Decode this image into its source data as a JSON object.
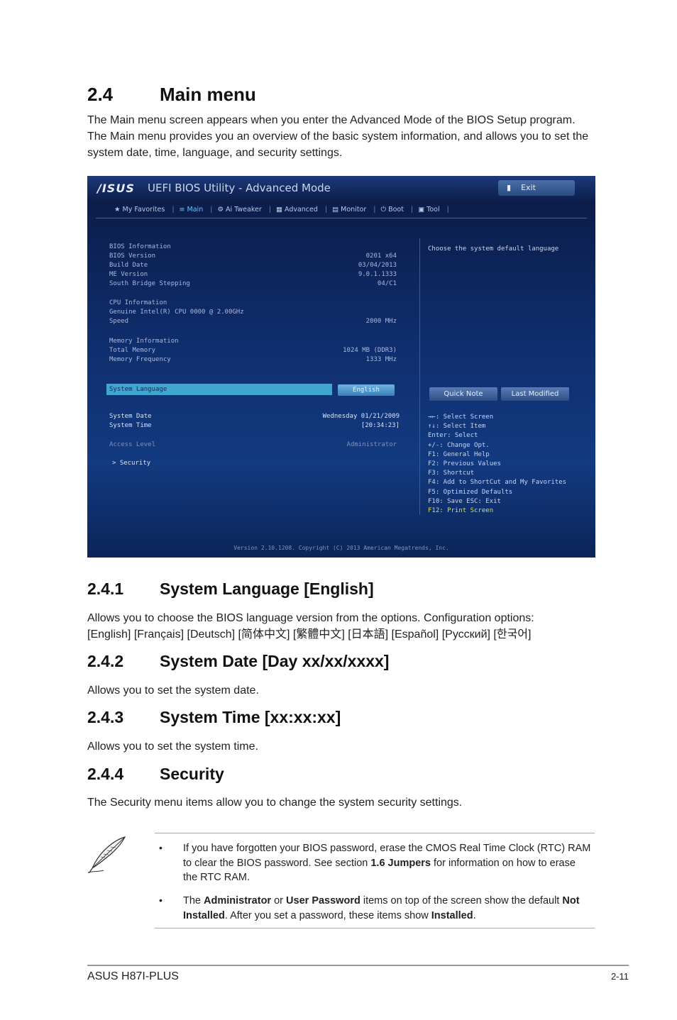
{
  "section": {
    "num": "2.4",
    "title": "Main menu",
    "intro": "The Main menu screen appears when you enter the Advanced Mode of the BIOS Setup program. The Main menu provides you an overview of the basic system information, and allows you to set the system date, time, language, and security settings."
  },
  "bios": {
    "logo": "/ISUS",
    "title": "UEFI BIOS Utility - Advanced Mode",
    "exit_label": "Exit",
    "tabs": [
      {
        "label": "My Favorites"
      },
      {
        "label": "Main"
      },
      {
        "label": "Ai Tweaker"
      },
      {
        "label": "Advanced"
      },
      {
        "label": "Monitor"
      },
      {
        "label": "Boot"
      },
      {
        "label": "Tool"
      }
    ],
    "bios_info": {
      "header": "BIOS Information",
      "version_label": "BIOS Version",
      "version": "0201 x64",
      "build_label": "Build Date",
      "build": "03/04/2013",
      "me_label": "ME Version",
      "me": "9.0.1.1333",
      "sb_label": "South Bridge Stepping",
      "sb": "04/C1"
    },
    "cpu_info": {
      "header": "CPU Information",
      "name": "Genuine Intel(R) CPU 0000 @ 2.00GHz",
      "speed_label": "Speed",
      "speed": "2000 MHz"
    },
    "mem_info": {
      "header": "Memory Information",
      "total_label": "Total Memory",
      "total": "1024 MB (DDR3)",
      "freq_label": "Memory Frequency",
      "freq": "1333 MHz"
    },
    "lang_label": "System Language",
    "lang_value": "English",
    "date_label": "System Date",
    "date": "Wednesday 01/21/2009",
    "time_label": "System Time",
    "time": "[20:34:23]",
    "access_label": "Access Level",
    "access": "Administrator",
    "security_label": "> Security",
    "help_text": "Choose the system default language",
    "quick_note": "Quick Note",
    "last_modified": "Last Modified",
    "keys": [
      "→←: Select Screen",
      "↑↓: Select Item",
      "Enter: Select",
      "+/-: Change Opt.",
      "F1: General Help",
      "F2: Previous Values",
      "F3: Shortcut",
      "F4: Add to ShortCut and My Favorites",
      "F5: Optimized Defaults",
      "F10: Save  ESC: Exit"
    ],
    "key_f12": "F12: Print Screen",
    "footer": "Version 2.10.1208. Copyright (C) 2013 American Megatrends, Inc."
  },
  "s241": {
    "num": "2.4.1",
    "title": "System Language [English]",
    "text1": "Allows you to choose the BIOS language version from the options. Configuration options:",
    "text2": "[English] [Français] [Deutsch] [简体中文] [繁體中文] [日本語] [Español] [Русский] [한국어]"
  },
  "s242": {
    "num": "2.4.2",
    "title": "System Date [Day xx/xx/xxxx]",
    "text": "Allows you to set the system date."
  },
  "s243": {
    "num": "2.4.3",
    "title": "System Time [xx:xx:xx]",
    "text": "Allows you to set the system time."
  },
  "s244": {
    "num": "2.4.4",
    "title": "Security",
    "text": "The Security menu items allow you to change the system security settings."
  },
  "note": {
    "bullet": "•",
    "item1_a": "If you have forgotten your BIOS password, erase the CMOS Real Time Clock (RTC) RAM to clear the BIOS password. See section ",
    "item1_b": "1.6 Jumpers",
    "item1_c": " for information on how to erase the RTC RAM.",
    "item2_a": "The ",
    "item2_b": "Administrator",
    "item2_c": " or ",
    "item2_d": "User Password",
    "item2_e": " items on top of the screen show the default ",
    "item2_f": "Not Installed",
    "item2_g": ". After you set a password, these items show ",
    "item2_h": "Installed",
    "item2_i": "."
  },
  "footer": {
    "left": "ASUS H87I-PLUS",
    "right": "2-11"
  }
}
